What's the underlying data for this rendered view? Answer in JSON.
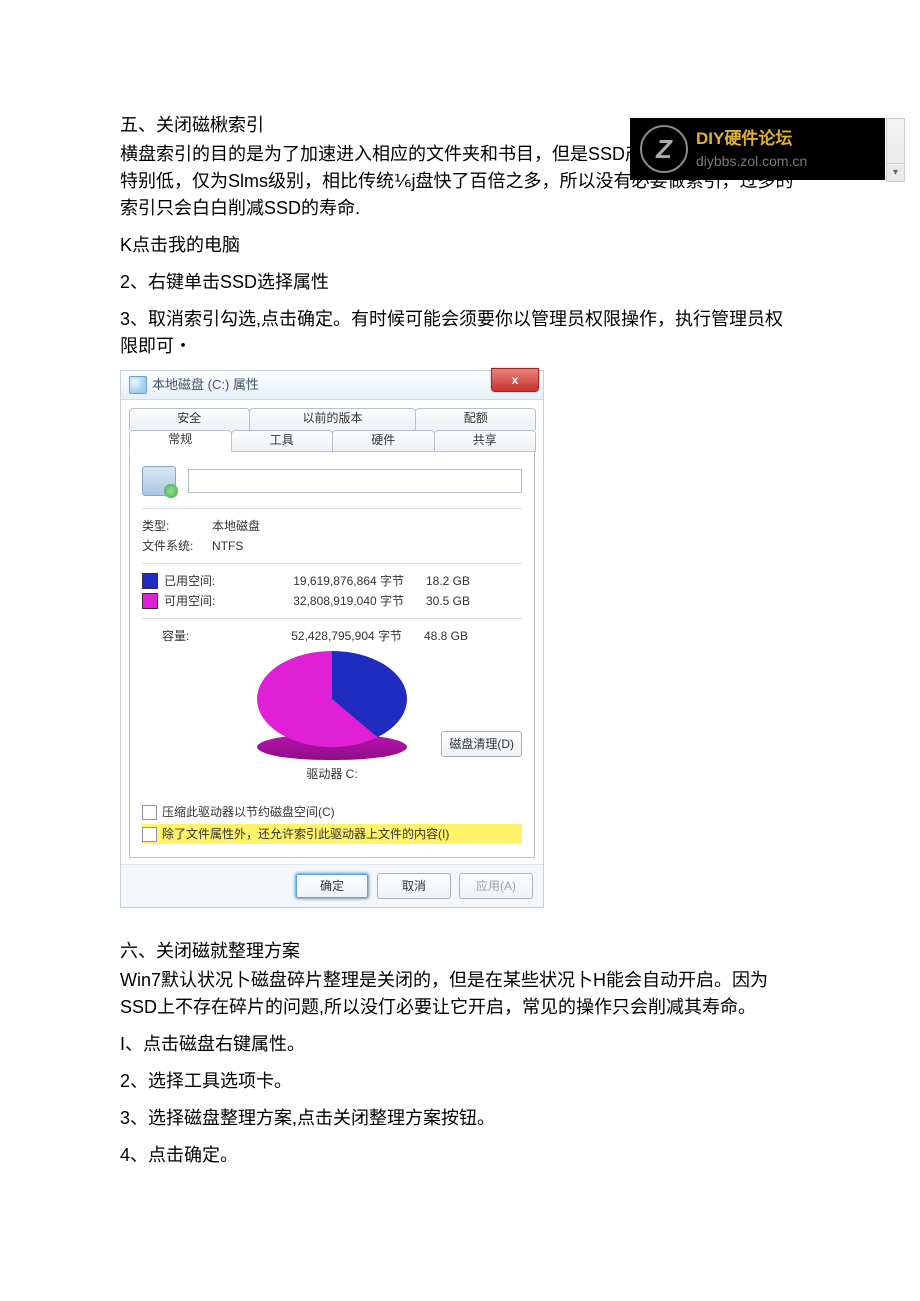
{
  "watermark": {
    "line1": "DIY硬件论坛",
    "line2": "diybbs.zol.com.cn",
    "logo_letter": "Z"
  },
  "section5": {
    "heading": "五、关闭磁楸索引",
    "para1": "横盘索引的目的是为了加速进入相应的文件夹和书目，但是SSD产品本身的响应时间特别低，仅为Slms级别，相比传统⅙j盘快了百倍之多，所以没有必要做索引，过多的索引只会白白削减SSD的寿命.",
    "step1": "K点击我的电脑",
    "step2": "2、右键单击SSD选择属性",
    "step3": "3、取消索引勾选,点击确定。有时候可能会须要你以管理员权限操作，执行管理员权限即可・"
  },
  "dialog": {
    "title": "本地磁盘 (C:) 属性",
    "close_label": "x",
    "tabs_back": [
      "安全",
      "以前的版本",
      "配额"
    ],
    "tabs_front": [
      "常规",
      "工具",
      "硬件",
      "共享"
    ],
    "active_tab": "常规",
    "name_value": "",
    "type_label": "类型:",
    "type_value": "本地磁盘",
    "fs_label": "文件系统:",
    "fs_value": "NTFS",
    "used_label": "已用空间:",
    "used_bytes": "19,619,876,864 字节",
    "used_gb": "18.2 GB",
    "free_label": "可用空间:",
    "free_bytes": "32,808,919,040 字节",
    "free_gb": "30.5 GB",
    "cap_label": "容量:",
    "cap_bytes": "52,428,795,904 字节",
    "cap_gb": "48.8 GB",
    "drive_caption": "驱动器 C:",
    "cleanup_btn": "磁盘清理(D)",
    "chk_compress": "压缩此驱动器以节约磁盘空间(C)",
    "chk_index": "除了文件属性外，还允许索引此驱动器上文件的内容(I)",
    "btn_ok": "确定",
    "btn_cancel": "取消",
    "btn_apply": "应用(A)"
  },
  "chart_data": {
    "type": "pie",
    "title": "驱动器 C:",
    "series": [
      {
        "name": "已用空间",
        "value_bytes": 19619876864,
        "value_gb": 18.2,
        "color": "#202cc0"
      },
      {
        "name": "可用空间",
        "value_bytes": 32808919040,
        "value_gb": 30.5,
        "color": "#e020d5"
      }
    ],
    "total_bytes": 52428795904,
    "total_gb": 48.8
  },
  "section6": {
    "heading": "六、关闭磁就整理方案",
    "para1": "Win7默认状况卜磁盘碎片整理是关闭的，但是在某些状况卜H能会自动开启。因为SSD上不存在碎片的问题,所以没仃必要让它开启，常见的操作只会削减其寿命。",
    "step1": "I、点击磁盘右键属性。",
    "step2": "2、选择工具选项卡。",
    "step3": "3、选择磁盘整理方案,点击关闭整理方案按钮。",
    "step4": "4、点击确定。"
  }
}
